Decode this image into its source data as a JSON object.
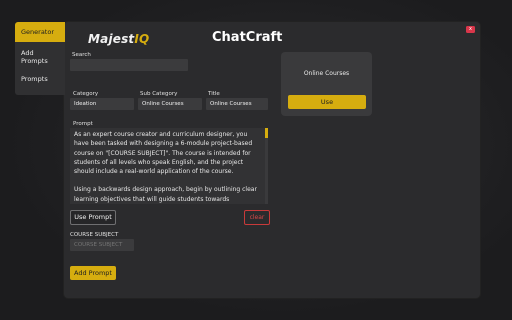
{
  "sidebar": {
    "items": [
      {
        "label": "Generator"
      },
      {
        "label": "Add Prompts"
      },
      {
        "label": "Prompts"
      }
    ]
  },
  "header": {
    "logo_main": "Majest",
    "logo_accent": "IQ",
    "app_title": "ChatCraft",
    "close_label": "x"
  },
  "form": {
    "search_label": "Search",
    "search_value": "",
    "category_label": "Category",
    "category_value": "Ideation",
    "subcategory_label": "Sub Category",
    "subcategory_value": "Online Courses",
    "title_label": "Title",
    "title_value": "Online Courses",
    "prompt_label": "Prompt",
    "prompt_paragraphs": [
      "As an expert course creator and curriculum designer, you have been tasked with designing a 6-module project-based course on \"[COURSE SUBJECT]\". The course is intended for students of all levels who speak English, and the project should include a real-world application of the course.",
      "Using a backwards design approach, begin by outlining clear learning objectives that will guide students towards"
    ],
    "use_prompt_label": "Use Prompt",
    "clear_label": "clear",
    "course_subject_label": "COURSE SUBJECT",
    "course_subject_placeholder": "COURSE SUBJECT",
    "add_prompt_label": "Add Prompt"
  },
  "card": {
    "title": "Online Courses",
    "use_label": "Use"
  },
  "colors": {
    "accent": "#d6ad0f",
    "danger": "#d94848",
    "panel": "#2b2b2d"
  }
}
